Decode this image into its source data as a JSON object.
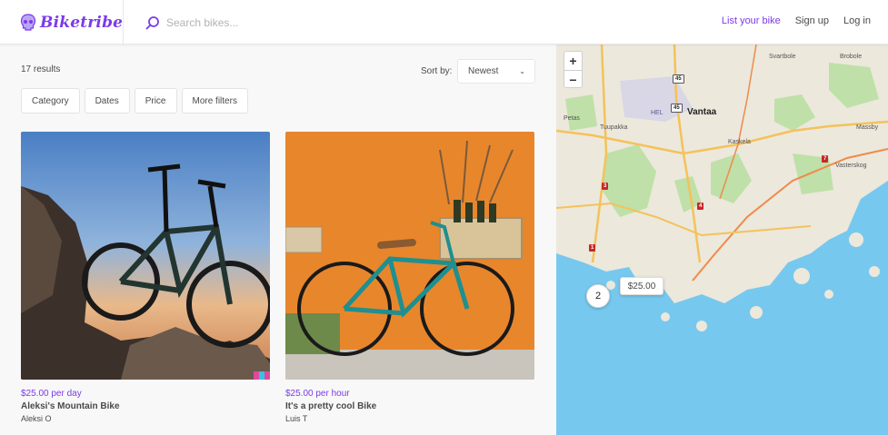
{
  "header": {
    "logo_text": "Biketribe",
    "search_placeholder": "Search bikes...",
    "nav": {
      "list_bike": "List your bike",
      "sign_up": "Sign up",
      "log_in": "Log in"
    }
  },
  "listings": {
    "results_count": "17 results",
    "sort_label": "Sort by:",
    "sort_value": "Newest",
    "filters": [
      "Category",
      "Dates",
      "Price",
      "More filters"
    ],
    "cards": [
      {
        "price": "$25.00 per day",
        "title": "Aleksi's Mountain Bike",
        "author": "Aleksi O"
      },
      {
        "price": "$25.00 per hour",
        "title": "It's a pretty cool Bike",
        "author": "Luis T"
      }
    ]
  },
  "map": {
    "zoom_in": "+",
    "zoom_out": "−",
    "price_marker": "$25.00",
    "cluster_count": "2",
    "labels": {
      "vantaa": "Vantaa",
      "tuupakka": "Tuupakka",
      "petas": "Petas",
      "hel": "HEL",
      "kaskela": "Kaskela",
      "vasterskog": "Vasterskog",
      "massby": "Massby",
      "svartbole": "Svartbole",
      "brobole": "Brobole"
    },
    "road_numbers": [
      "45",
      "45",
      "3",
      "4",
      "7",
      "1"
    ]
  },
  "colors": {
    "accent": "#7c3aed",
    "water": "#77c8ee",
    "land": "#ece8dc",
    "park": "#bfe0a8"
  }
}
